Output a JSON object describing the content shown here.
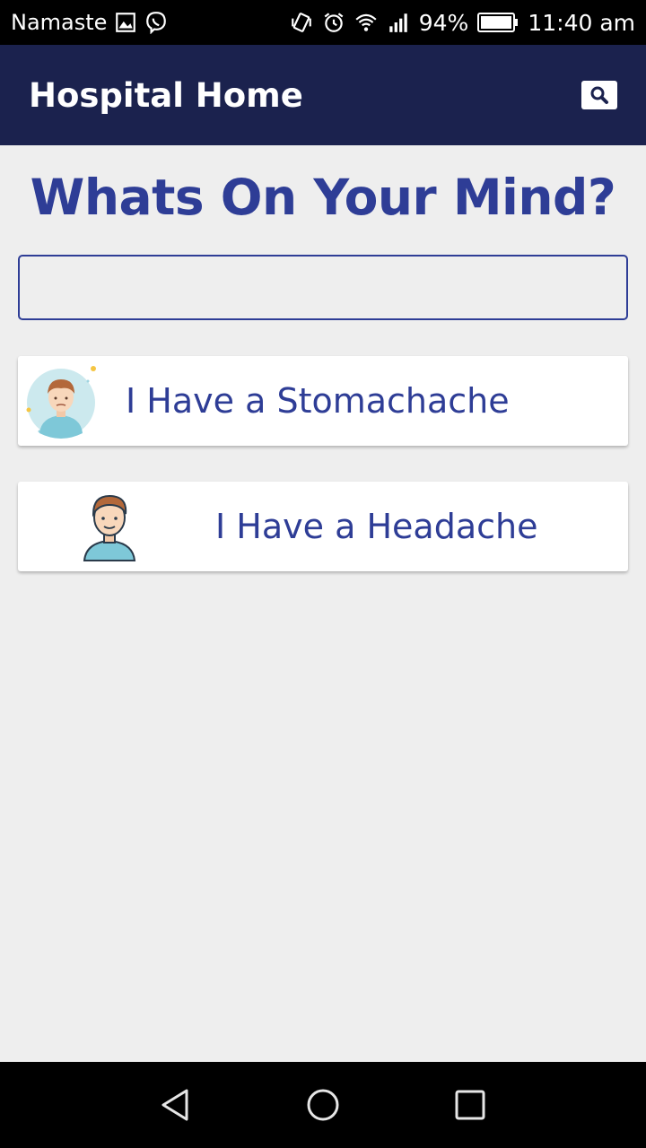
{
  "status_bar": {
    "carrier": "Namaste",
    "battery_percent": "94%",
    "time": "11:40 am",
    "icons": [
      "image-icon",
      "viber-icon",
      "vibrate-icon",
      "alarm-icon",
      "wifi-icon",
      "signal-icon",
      "battery-icon"
    ]
  },
  "app_bar": {
    "title": "Hospital Home",
    "action_icon": "search-icon",
    "color": "#1b224e"
  },
  "main": {
    "heading": "Whats On Your Mind?",
    "input": {
      "value": "",
      "placeholder": ""
    },
    "options": [
      {
        "label": "I Have a Stomachache",
        "icon": "sick-person-avatar-icon"
      },
      {
        "label": "I Have a Headache",
        "icon": "person-avatar-icon"
      }
    ],
    "accent_color": "#2e3d96"
  },
  "nav_bar": {
    "buttons": [
      "back-icon",
      "home-icon",
      "recents-icon"
    ]
  }
}
